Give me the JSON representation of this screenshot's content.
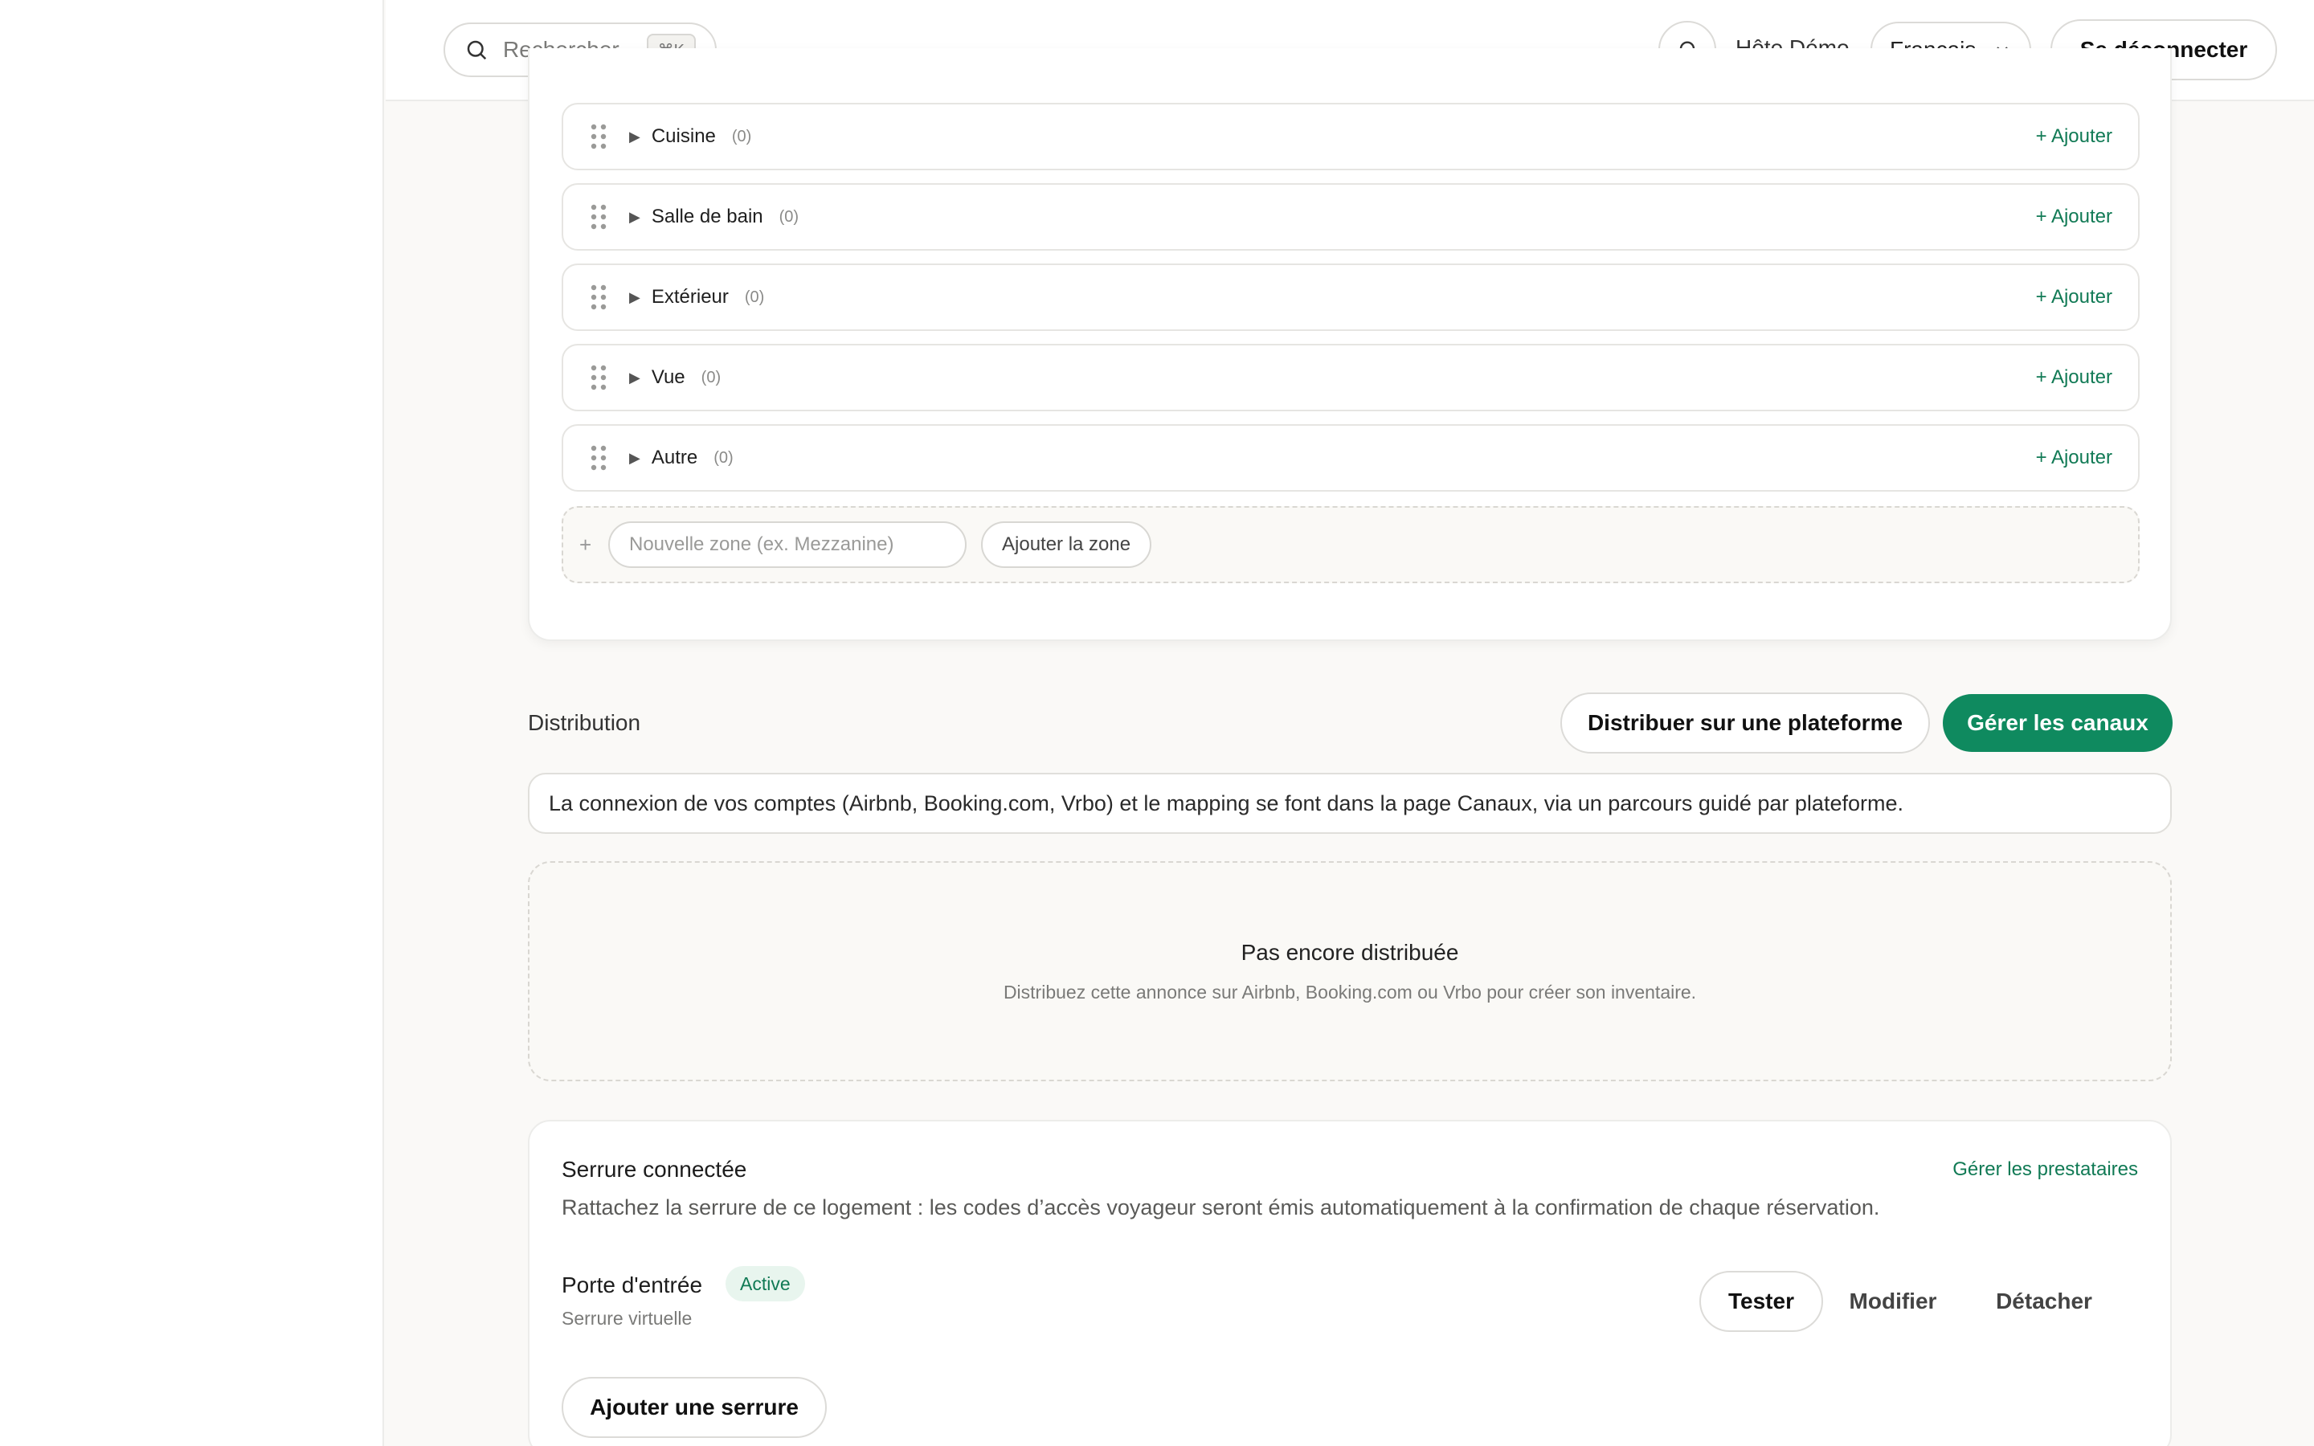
{
  "header": {
    "search_placeholder": "Rechercher",
    "search_shortcut": "⌘K",
    "host_name": "Hôte Démo",
    "language": "Français",
    "logout_label": "Se déconnecter"
  },
  "zones": {
    "items": [
      {
        "name": "Cuisine",
        "count": "(0)",
        "add_label": "+ Ajouter"
      },
      {
        "name": "Salle de bain",
        "count": "(0)",
        "add_label": "+ Ajouter"
      },
      {
        "name": "Extérieur",
        "count": "(0)",
        "add_label": "+ Ajouter"
      },
      {
        "name": "Vue",
        "count": "(0)",
        "add_label": "+ Ajouter"
      },
      {
        "name": "Autre",
        "count": "(0)",
        "add_label": "+ Ajouter"
      }
    ],
    "new_zone_placeholder": "Nouvelle zone (ex. Mezzanine)",
    "add_zone_label": "Ajouter la zone"
  },
  "distribution": {
    "title": "Distribution",
    "distribute_label": "Distribuer sur une plateforme",
    "manage_channels_label": "Gérer les canaux",
    "info_text": "La connexion de vos comptes (Airbnb, Booking.com, Vrbo) et le mapping se font dans la page Canaux, via un parcours guidé par plateforme.",
    "empty_title": "Pas encore distribuée",
    "empty_subtitle": "Distribuez cette annonce sur Airbnb, Booking.com ou Vrbo pour créer son inventaire."
  },
  "lock": {
    "title": "Serrure connectée",
    "manage_providers_label": "Gérer les prestataires",
    "description": "Rattachez la serrure de ce logement : les codes d’accès voyageur seront émis automatiquement à la confirmation de chaque réservation.",
    "device_name": "Porte d'entrée",
    "status": "Active",
    "device_type": "Serrure virtuelle",
    "test_label": "Tester",
    "edit_label": "Modifier",
    "detach_label": "Détacher",
    "add_lock_label": "Ajouter une serrure"
  },
  "colors": {
    "accent": "#0f8a5f",
    "link": "#117a55",
    "background": "#faf9f7"
  }
}
